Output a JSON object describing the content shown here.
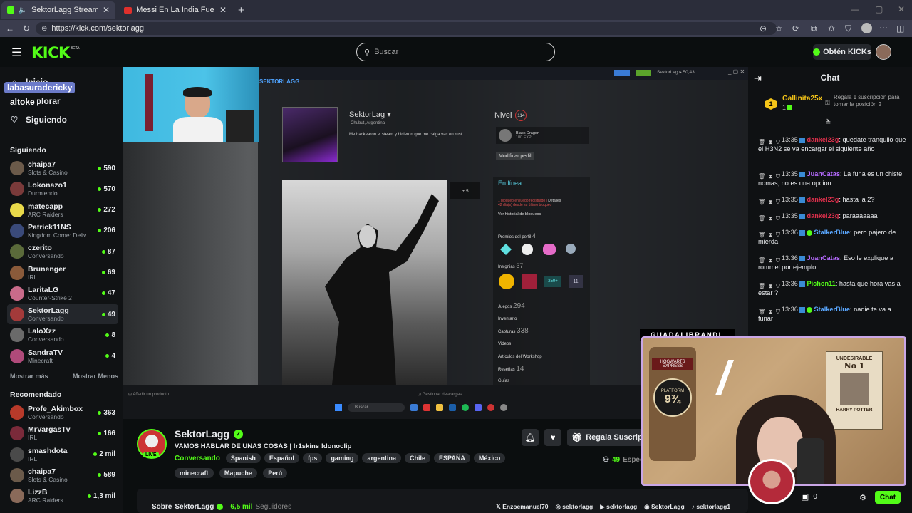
{
  "browser": {
    "tabs": [
      {
        "title": "SektorLagg Stream - Watch Li"
      },
      {
        "title": "Messi En La India Fue Un Desastre"
      }
    ],
    "url": "https://kick.com/sektorlagg"
  },
  "header": {
    "logo": "KICK",
    "logo_badge": "BETA",
    "search_placeholder": "Buscar",
    "get_kicks": "Obtén KICKs"
  },
  "sidebar": {
    "nav": [
      "Inicio",
      "Explorar",
      "Siguiendo"
    ],
    "overlay_user_1": "labasuradericky",
    "overlay_user_2": "altoke",
    "following_title": "Siguiendo",
    "following": [
      {
        "name": "chaipa7",
        "category": "Slots & Casino",
        "viewers": "590",
        "color": "#6b5a4a"
      },
      {
        "name": "Lokonazo1",
        "category": "Durmiendo",
        "viewers": "570",
        "color": "#7a3a3a"
      },
      {
        "name": "matecapp",
        "category": "ARC Raiders",
        "viewers": "272",
        "color": "#e8d94a"
      },
      {
        "name": "Patrick11NS",
        "category": "Kingdom Come: Deliv...",
        "viewers": "206",
        "color": "#3a4a7a"
      },
      {
        "name": "czerito",
        "category": "Conversando",
        "viewers": "87",
        "color": "#5a6a3a"
      },
      {
        "name": "Brunenger",
        "category": "IRL",
        "viewers": "69",
        "color": "#8a5a3a"
      },
      {
        "name": "LaritaLG",
        "category": "Counter-Strike 2",
        "viewers": "47",
        "color": "#c96b8a"
      },
      {
        "name": "SektorLagg",
        "category": "Conversando",
        "viewers": "49",
        "color": "#a33a3a"
      },
      {
        "name": "LaloXzz",
        "category": "Conversando",
        "viewers": "8",
        "color": "#6a6a6a"
      },
      {
        "name": "SandraTV",
        "category": "Minecraft",
        "viewers": "4",
        "color": "#b04a7a"
      }
    ],
    "show_more": "Mostrar más",
    "show_less": "Mostrar Menos",
    "recommended_title": "Recomendado",
    "recommended": [
      {
        "name": "Profe_Akimbox",
        "category": "Conversando",
        "viewers": "363",
        "color": "#b83a2a"
      },
      {
        "name": "MrVargasTv",
        "category": "IRL",
        "viewers": "166",
        "color": "#7a2a3a"
      },
      {
        "name": "smashdota",
        "category": "IRL",
        "viewers": "2 mil",
        "color": "#4a4a4a"
      },
      {
        "name": "chaipa7",
        "category": "Slots & Casino",
        "viewers": "589",
        "color": "#6b5a4a"
      },
      {
        "name": "LizzB",
        "category": "ARC Raiders",
        "viewers": "1,3 mil",
        "color": "#8a6a5a"
      }
    ]
  },
  "stream_content": {
    "profile_tab": "SEKTORLAGG",
    "profile_name": "SektorLag",
    "profile_location": "Chubut, Argentina",
    "profile_summary": "Me hackearon el steam y hicieron que me caiga vac en rust",
    "level_label": "Nivel",
    "level": "114",
    "badge_name": "Black Dragon",
    "badge_xp": "100 EXP",
    "edit_profile": "Modificar perfil",
    "online": "En línea",
    "ban_line_1": "1 bloqueo en juego registrado |",
    "ban_details": "Detalles",
    "ban_line_2": "42 día(s) desde su último bloqueo",
    "ban_history": "Ver historial de bloqueos",
    "awards_label": "Premios del perfil",
    "awards_count": "4",
    "badges_label": "Insignias",
    "badges_count": "37",
    "badge_250": "250+",
    "badge_11": "11",
    "games_label": "Juegos",
    "games_count": "294",
    "inventory": "Inventario",
    "screenshots_label": "Capturas",
    "screenshots_count": "338",
    "videos": "Videos",
    "workshop": "Artículos del Workshop",
    "reviews_label": "Reseñas",
    "reviews_count": "14",
    "guides": "Guías",
    "plus5": "+ 5",
    "add_product": "Añadir un producto",
    "manage_downloads": "Gestionar descargas",
    "taskbar_search": "Buscar",
    "steam_window_user": "SektorLag",
    "steam_window_balance": "50,43"
  },
  "channel": {
    "name": "SektorLagg",
    "live_badge": "LIVE",
    "title": "VAMOS HABLAR DE UNAS COSAS | !r1skins !donoclip",
    "category": "Conversando",
    "tags": [
      "Spanish",
      "Español",
      "fps",
      "gaming",
      "argentina",
      "Chile",
      "ESPAÑA",
      "México",
      "minecraft",
      "Mapuche",
      "Perú"
    ],
    "gift_button": "Regala Suscripciones",
    "viewers": "49",
    "viewers_label": "Espectadores",
    "about_prefix": "Sobre",
    "about_name": "SektorLagg",
    "followers": "6,5 mil",
    "followers_label": "Seguidores",
    "socials": [
      "Enzoemanuel70",
      "sektorlagg",
      "sektorlagg",
      "SektorLagg",
      "sektorlagg1"
    ]
  },
  "chat": {
    "title": "Chat",
    "pinned_user": "Gallinita25x",
    "pinned_rank": "1",
    "pinned_count": "1",
    "pinned_text": "Regala 1 suscripción para tomar la posición 2",
    "messages": [
      {
        "time": "13:35",
        "user": "dankel23g",
        "color": "#e0304c",
        "text": "quedate tranquilo que el H3N2 se va encargar el siguiente año",
        "badge": false
      },
      {
        "time": "13:35",
        "user": "JuanCatas",
        "color": "#b66bff",
        "text": "La funa es un chiste nomas, no es una opcion",
        "badge": false
      },
      {
        "time": "13:35",
        "user": "dankel23g",
        "color": "#e0304c",
        "text": "hasta la 2?",
        "badge": false
      },
      {
        "time": "13:35",
        "user": "dankel23g",
        "color": "#e0304c",
        "text": "paraaaaaaa",
        "badge": false
      },
      {
        "time": "13:36",
        "user": "StalkerBlue",
        "color": "#5aa7ff",
        "text": "pero pajero de mierda",
        "badge": true
      },
      {
        "time": "13:36",
        "user": "JuanCatas",
        "color": "#b66bff",
        "text": "Eso le explique a rommel por ejemplo",
        "badge": false
      },
      {
        "time": "13:36",
        "user": "Pichon11",
        "color": "#53fc18",
        "text": "hasta que hora vas a estar ?",
        "badge": false
      },
      {
        "time": "13:36",
        "user": "StalkerBlue",
        "color": "#5aa7ff",
        "text": "nadie te va a funar",
        "badge": true
      }
    ],
    "overlay_name": "GUADALIBRANDI",
    "poster_title": "UNDESIRABLE",
    "poster_no": "No 1",
    "poster_name": "HARRY POTTER",
    "sign_top": "HOGWARTS EXPRESS",
    "sign_platform": "PLATFORM",
    "sign_number": "9¾",
    "kicks_balance": "0",
    "chat_button": "Chat"
  },
  "colors": {
    "brand": "#53fc18",
    "bg": "#0b0e0f",
    "verified": "#53fc18"
  }
}
